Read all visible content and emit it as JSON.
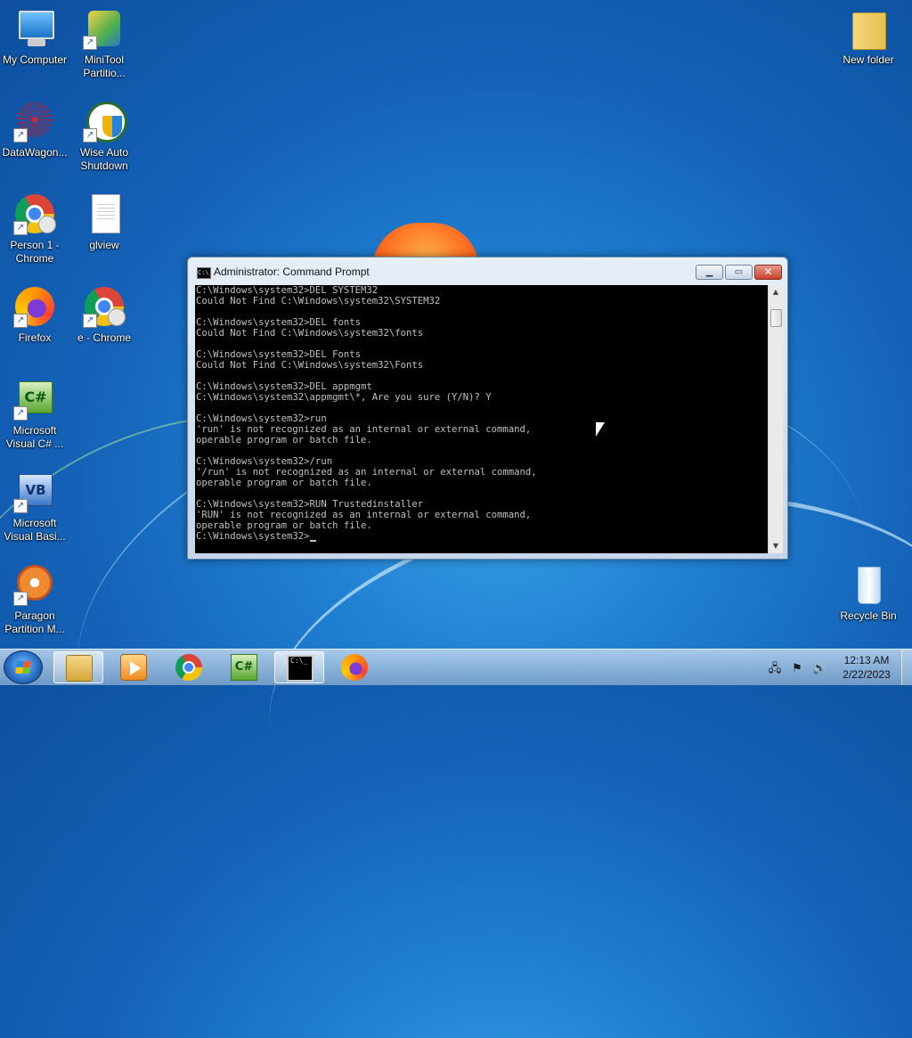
{
  "desktop": {
    "icons": [
      {
        "label": "My Computer",
        "icon": "computer-icon"
      },
      {
        "label": "MiniTool Partitio...",
        "icon": "minitool-partition-icon"
      },
      {
        "label": "DataWagon...",
        "icon": "datawagon-icon"
      },
      {
        "label": "Wise Auto Shutdown",
        "icon": "wise-auto-shutdown-icon"
      },
      {
        "label": "Person 1 - Chrome",
        "icon": "chrome-icon"
      },
      {
        "label": "glview",
        "icon": "document-icon"
      },
      {
        "label": "Firefox",
        "icon": "firefox-icon"
      },
      {
        "label": "e - Chrome",
        "icon": "chrome-icon"
      },
      {
        "label": "Microsoft Visual C# ...",
        "icon": "visual-csharp-icon"
      },
      {
        "label": "Microsoft Visual Basi...",
        "icon": "visual-basic-icon"
      },
      {
        "label": "Paragon Partition M...",
        "icon": "paragon-partition-icon"
      },
      {
        "label": "New folder",
        "icon": "folder-icon"
      },
      {
        "label": "Recycle Bin",
        "icon": "recycle-bin-icon"
      }
    ]
  },
  "cmd_window": {
    "title": "Administrator: Command Prompt",
    "icon_text": "C:\\",
    "buttons": {
      "minimize": "▁",
      "maximize": "▭",
      "close": "✕"
    },
    "output": "C:\\Windows\\system32>DEL SYSTEM32\nCould Not Find C:\\Windows\\system32\\SYSTEM32\n\nC:\\Windows\\system32>DEL fonts\nCould Not Find C:\\Windows\\system32\\fonts\n\nC:\\Windows\\system32>DEL Fonts\nCould Not Find C:\\Windows\\system32\\Fonts\n\nC:\\Windows\\system32>DEL appmgmt\nC:\\Windows\\system32\\appmgmt\\*, Are you sure (Y/N)? Y\n\nC:\\Windows\\system32>run\n'run' is not recognized as an internal or external command,\noperable program or batch file.\n\nC:\\Windows\\system32>/run\n'/run' is not recognized as an internal or external command,\noperable program or batch file.\n\nC:\\Windows\\system32>RUN Trustedinstaller\n'RUN' is not recognized as an internal or external command,\noperable program or batch file.\n",
    "prompt": "C:\\Windows\\system32>",
    "scroll_up": "▲",
    "scroll_down": "▼"
  },
  "taskbar": {
    "pinned": [
      "windows-explorer-icon",
      "media-player-icon",
      "chrome-icon",
      "visual-csharp-icon",
      "command-prompt-icon",
      "firefox-icon"
    ],
    "active": "command-prompt-icon",
    "csharp_text": "C#",
    "cmd_text": "C:\\_",
    "tray": {
      "network": "🖧",
      "flag": "⚑",
      "volume": "🔊"
    },
    "clock": {
      "time": "12:13 AM",
      "date": "2/22/2023"
    }
  }
}
